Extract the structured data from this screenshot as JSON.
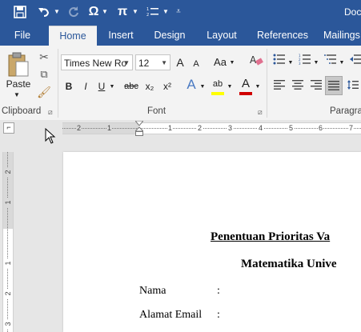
{
  "title_bar": {
    "doc_title": "Doc",
    "save_icon": "save-icon",
    "undo_icon": "undo-icon",
    "redo_icon": "redo-icon",
    "symbol_glyph": "Ω",
    "equation_glyph": "π"
  },
  "tabs": [
    {
      "label": "File",
      "active": false
    },
    {
      "label": "Home",
      "active": true
    },
    {
      "label": "Insert",
      "active": false
    },
    {
      "label": "Design",
      "active": false
    },
    {
      "label": "Layout",
      "active": false
    },
    {
      "label": "References",
      "active": false
    },
    {
      "label": "Mailings",
      "active": false
    }
  ],
  "ribbon": {
    "clipboard": {
      "paste_label": "Paste",
      "group_label": "Clipboard"
    },
    "font": {
      "font_name": "Times New Ro",
      "font_size": "12",
      "grow_glyph": "A",
      "shrink_glyph": "A",
      "case_glyph": "Aa",
      "bold": "B",
      "italic": "I",
      "underline": "U",
      "strike": "abc",
      "subscript": "x₂",
      "superscript": "x²",
      "effects_glyph": "A",
      "highlight_glyph": "ab",
      "color_glyph": "A",
      "group_label": "Font"
    },
    "paragraph": {
      "group_label": "Paragra"
    },
    "colors": {
      "accent": "#2b579a",
      "highlight": "#ffff00",
      "font_color": "#d00000"
    }
  },
  "ruler": {
    "horizontal_ticks": [
      "2",
      "1",
      "1",
      "2",
      "3",
      "4",
      "5",
      "6",
      "7"
    ],
    "vertical_ticks": [
      "2",
      "1",
      "1",
      "2",
      "3"
    ]
  },
  "document": {
    "title_line1": "Penentuan Prioritas Va",
    "title_line2": "Matematika Unive",
    "fields": [
      {
        "label": "Nama",
        "sep": ":"
      },
      {
        "label": "Alamat Email",
        "sep": ":"
      }
    ]
  }
}
